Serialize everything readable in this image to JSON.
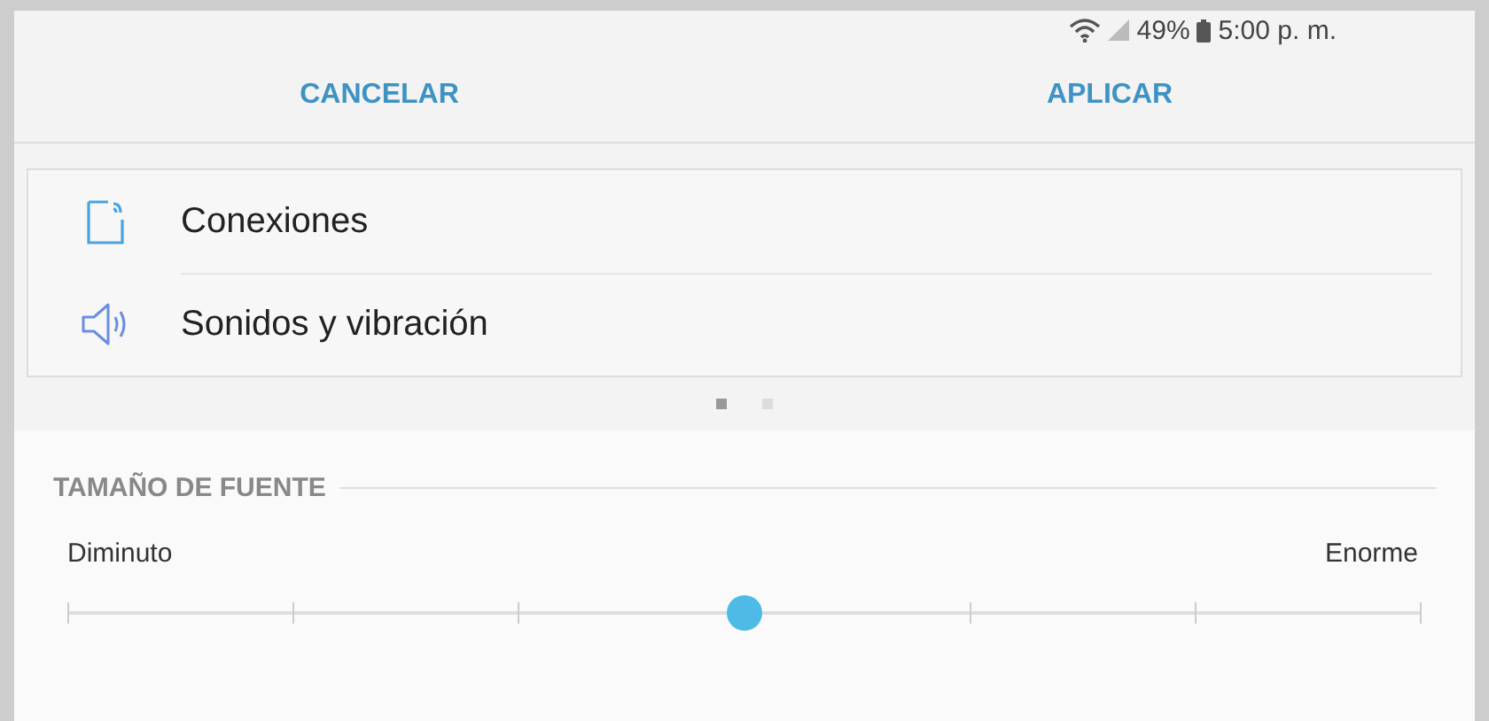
{
  "status_bar": {
    "battery": "49%",
    "time": "5:00 p. m."
  },
  "header": {
    "buttons": [
      "CANCELAR",
      "APLICAR"
    ]
  },
  "preview_items": [
    {
      "kind": "connections",
      "label": "Conexiones"
    },
    {
      "kind": "sound",
      "label": "Sonidos y vibración"
    }
  ],
  "page_dots": [
    {
      "selected": true
    },
    {
      "selected": false
    }
  ],
  "font_size": {
    "title": "TAMAÑO DE FUENTE",
    "min_label": "Diminuto",
    "max_label": "Enorme",
    "level": 0.5
  }
}
